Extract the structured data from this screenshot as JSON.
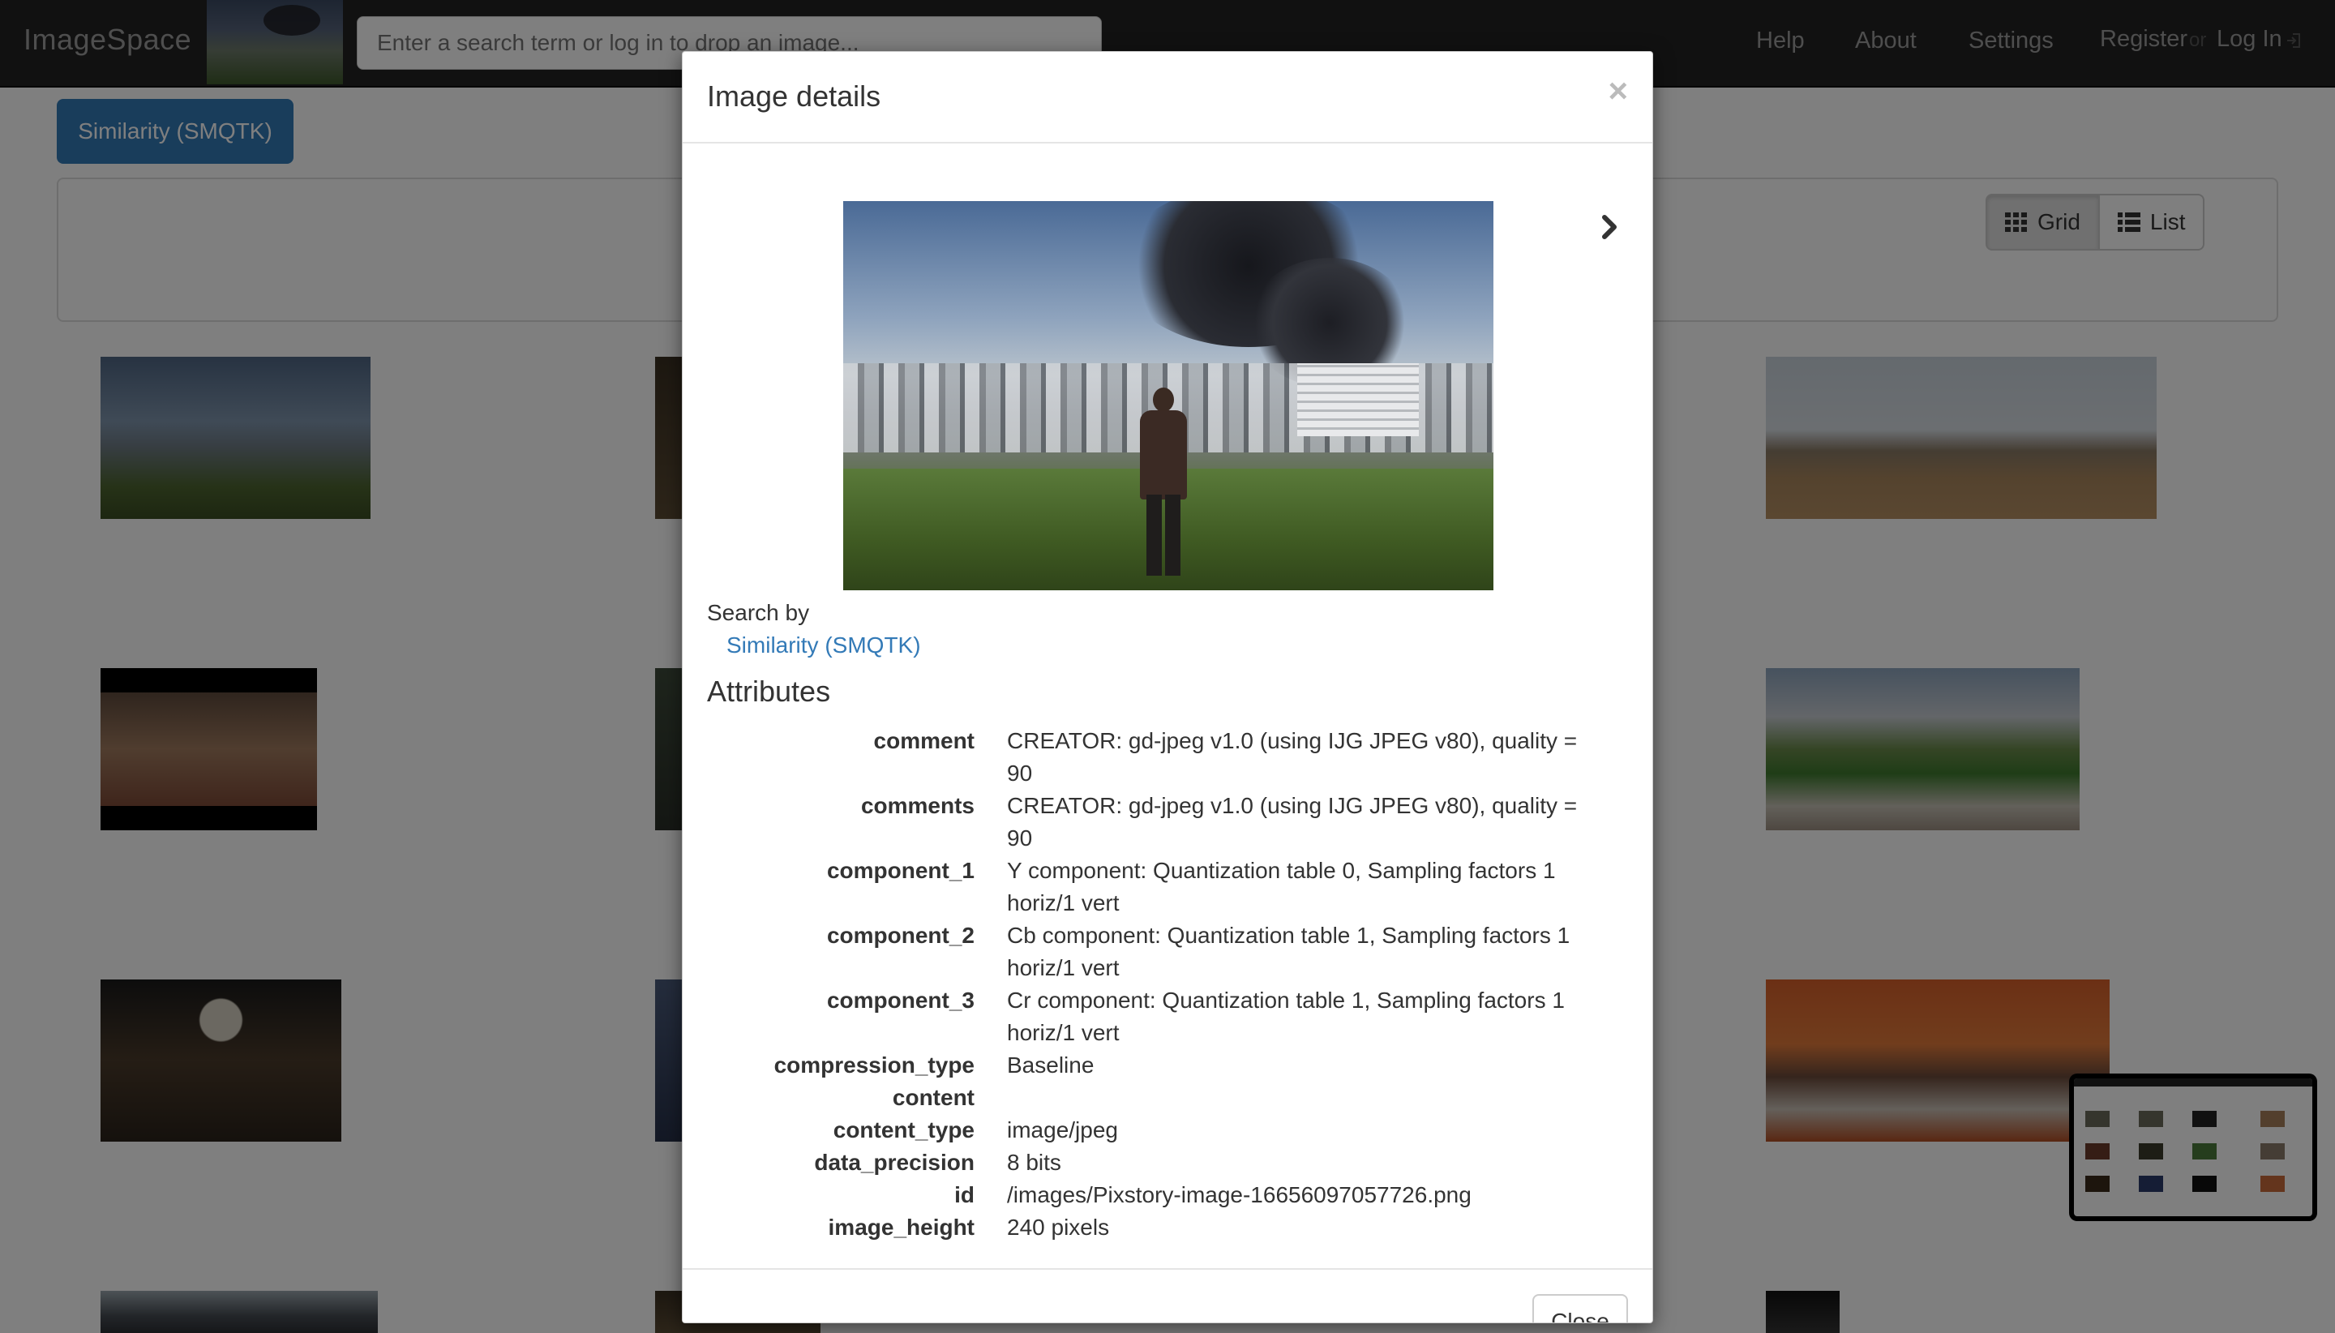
{
  "navbar": {
    "brand": "ImageSpace",
    "search_placeholder": "Enter a search term or log in to drop an image...",
    "links": {
      "help": "Help",
      "about": "About",
      "settings": "Settings",
      "register": "Register",
      "or": "or",
      "login": "Log In"
    }
  },
  "page": {
    "similarity_tab": "Similarity (SMQTK)",
    "view_toggle": {
      "grid": "Grid",
      "list": "List"
    }
  },
  "modal": {
    "title": "Image details",
    "close_x": "×",
    "search_by_label": "Search by",
    "search_by_link": "Similarity (SMQTK)",
    "attributes_heading": "Attributes",
    "attributes": [
      {
        "key": "comment",
        "value": "CREATOR: gd-jpeg v1.0 (using IJG JPEG v80), quality = 90"
      },
      {
        "key": "comments",
        "value": "CREATOR: gd-jpeg v1.0 (using IJG JPEG v80), quality = 90"
      },
      {
        "key": "component_1",
        "value": "Y component: Quantization table 0, Sampling factors 1 horiz/1 vert"
      },
      {
        "key": "component_2",
        "value": "Cb component: Quantization table 1, Sampling factors 1 horiz/1 vert"
      },
      {
        "key": "component_3",
        "value": "Cr component: Quantization table 1, Sampling factors 1 horiz/1 vert"
      },
      {
        "key": "compression_type",
        "value": "Baseline"
      },
      {
        "key": "content",
        "value": ""
      },
      {
        "key": "content_type",
        "value": "image/jpeg"
      },
      {
        "key": "data_precision",
        "value": "8 bits"
      },
      {
        "key": "id",
        "value": "/images/Pixstory-image-16656097057726.png"
      },
      {
        "key": "image_height",
        "value": "240 pixels"
      }
    ],
    "close_button": "Close"
  },
  "colors": {
    "navbar_bg": "#222222",
    "primary": "#337ab7",
    "backdrop": "rgba(0,0,0,0.5)"
  },
  "icons": {
    "next": "chevron-right-icon",
    "grid": "grid-icon",
    "list": "list-icon",
    "login": "login-icon",
    "close": "close-icon"
  }
}
